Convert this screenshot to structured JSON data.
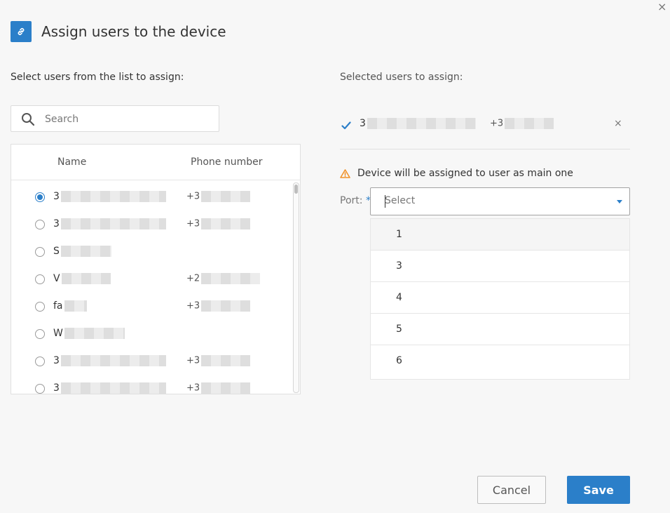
{
  "dialog": {
    "title": "Assign users to the device",
    "close_glyph": "×",
    "header_icon": "link-icon",
    "accent_color": "#2b7fc9"
  },
  "left": {
    "label": "Select users from the list to assign:",
    "search": {
      "placeholder": "Search",
      "value": ""
    },
    "columns": {
      "name": "Name",
      "phone": "Phone number"
    },
    "rows": [
      {
        "name": "3",
        "phone": "+3",
        "checked": true
      },
      {
        "name": "3",
        "phone": "+3",
        "checked": false
      },
      {
        "name": "S",
        "phone": "",
        "checked": false
      },
      {
        "name": "V",
        "phone": "+2",
        "checked": false
      },
      {
        "name": "fa",
        "phone": "+3",
        "checked": false
      },
      {
        "name": "W",
        "phone": "",
        "checked": false
      },
      {
        "name": "3",
        "phone": "+3",
        "checked": false
      },
      {
        "name": "3",
        "phone": "+3",
        "checked": false
      }
    ]
  },
  "right": {
    "label": "Selected users to assign:",
    "selected_user": {
      "name": "3",
      "phone": "+3",
      "remove_glyph": "×"
    },
    "warning": "Device will be assigned to user as main one",
    "port": {
      "label": "Port:",
      "required_mark": "*",
      "placeholder": "Select",
      "options": [
        "1",
        "3",
        "4",
        "5",
        "6"
      ]
    }
  },
  "footer": {
    "cancel_label": "Cancel",
    "save_label": "Save"
  }
}
